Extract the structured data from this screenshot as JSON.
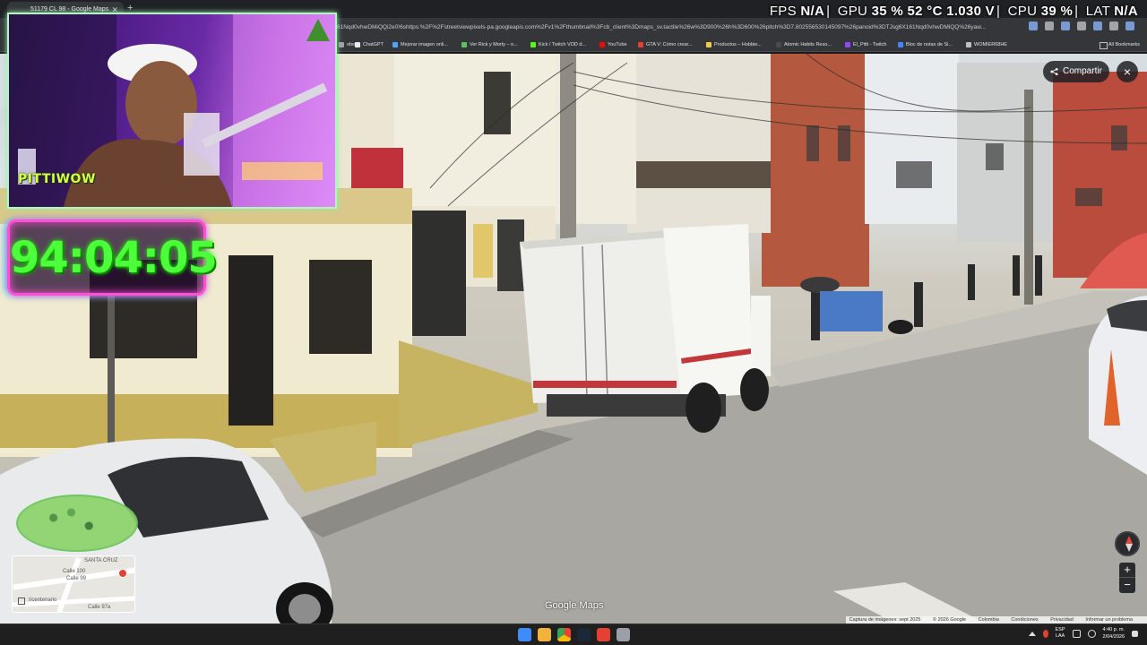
{
  "browser": {
    "tab_title": "51179 CL 98 - Google Maps",
    "url": "61Nqd0vhwDMiQQi2e0!6shttps:%2F%2Fstreetviewpixels-pa.googleapis.com%2Fv1%2Fthumbnail%3Fcb_client%3Dmaps_sv.tactile%26w%3D900%26h%3D600%26pitch%3D7.802556530145097%26panoid%3DTJsg6X161Nqd0vhwDMiQQ%26yaw...",
    "bookmarks": [
      {
        "label": "obe",
        "color": "#9aa0a6"
      },
      {
        "label": "ChatGPT",
        "color": "#e8eaed"
      },
      {
        "label": "Mejorar imagen onli...",
        "color": "#4aa3ff"
      },
      {
        "label": "Ver Rick y Morty – o...",
        "color": "#5cc35c"
      },
      {
        "label": "Kick / Twitch VOD d...",
        "color": "#53fc18"
      },
      {
        "label": "YouTube",
        "color": "#ff0000"
      },
      {
        "label": "GTA V: Cómo crear...",
        "color": "#e34133"
      },
      {
        "label": "Productos – Hobbie...",
        "color": "#f2c94c"
      },
      {
        "label": "Atomic Habits Reso...",
        "color": "#222"
      },
      {
        "label": "El_Pitti - Twitch",
        "color": "#9146ff"
      },
      {
        "label": "Bloc de notas de Si...",
        "color": "#4285f4"
      },
      {
        "label": "WOMIER68HE",
        "color": "#bdc1c6"
      }
    ],
    "all_bookmarks": "All Bookmarks"
  },
  "perf": {
    "fps_label": "FPS",
    "fps_value": "N/A",
    "gpu_label": "GPU",
    "gpu_load": "35 %",
    "gpu_temp": "52 °C",
    "gpu_volt": "1.030 V",
    "cpu_label": "CPU",
    "cpu_load": "39 %",
    "lat_label": "LAT",
    "lat_value": "N/A"
  },
  "stream": {
    "cam_badge": "PITTIWOW",
    "timer": "94:04:05"
  },
  "maps": {
    "share_label": "Compartir",
    "close_icon": "×",
    "zoom_in": "+",
    "zoom_out": "−",
    "logo": "Google Maps",
    "attribution": [
      "Captura de imágenes: sept 2025",
      "© 2026 Google",
      "Colombia",
      "Condiciones",
      "Privacidad",
      "Informar un problema"
    ],
    "minimap": {
      "labels": [
        "SANTA CRUZ",
        "Calle 100",
        "Calle 99",
        "Calle 97a",
        "ricentenario"
      ]
    }
  },
  "taskbar": {
    "lang": "ESP",
    "lang2": "LAA",
    "time": "4:40 p. m.",
    "date": "2/04/2026",
    "icons": [
      "windows-icon",
      "file-explorer-icon",
      "chrome-icon",
      "steam-icon",
      "app-red-icon",
      "app-grid-icon"
    ]
  }
}
